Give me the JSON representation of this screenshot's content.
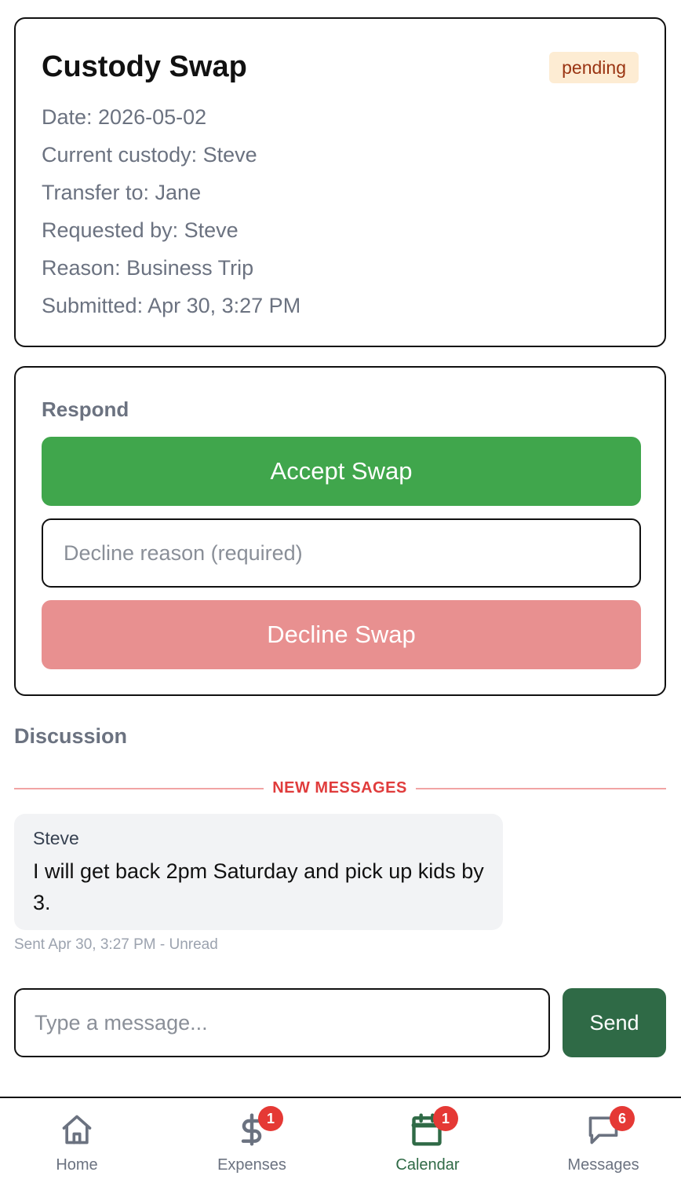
{
  "swap": {
    "title": "Custody Swap",
    "status": "pending",
    "date": "Date: 2026-05-02",
    "current_custody": "Current custody: Steve",
    "transfer_to": "Transfer to: Jane",
    "requested_by": "Requested by: Steve",
    "reason": "Reason: Business Trip",
    "submitted": "Submitted: Apr 30, 3:27 PM"
  },
  "respond": {
    "label": "Respond",
    "accept_label": "Accept Swap",
    "decline_placeholder": "Decline reason (required)",
    "decline_label": "Decline Swap"
  },
  "discussion": {
    "label": "Discussion",
    "new_messages_label": "NEW MESSAGES",
    "messages": [
      {
        "sender": "Steve",
        "text": "I will get back 2pm Saturday and pick up kids by 3.",
        "meta": "Sent Apr 30, 3:27 PM - Unread"
      }
    ],
    "input_placeholder": "Type a message...",
    "send_label": "Send"
  },
  "tabs": [
    {
      "label": "Home",
      "icon": "home-icon"
    },
    {
      "label": "Expenses",
      "icon": "dollar-icon",
      "badge": "1"
    },
    {
      "label": "Calendar",
      "icon": "calendar-icon",
      "badge": "1",
      "active": true
    },
    {
      "label": "Messages",
      "icon": "chat-icon",
      "badge": "6"
    }
  ],
  "colors": {
    "accept": "#40a64c",
    "decline": "#e89090",
    "send": "#2f6a46",
    "badge": "#e53935",
    "pending_bg": "#fdecd3",
    "pending_text": "#9a3412",
    "active_tab": "#2f6a46"
  }
}
